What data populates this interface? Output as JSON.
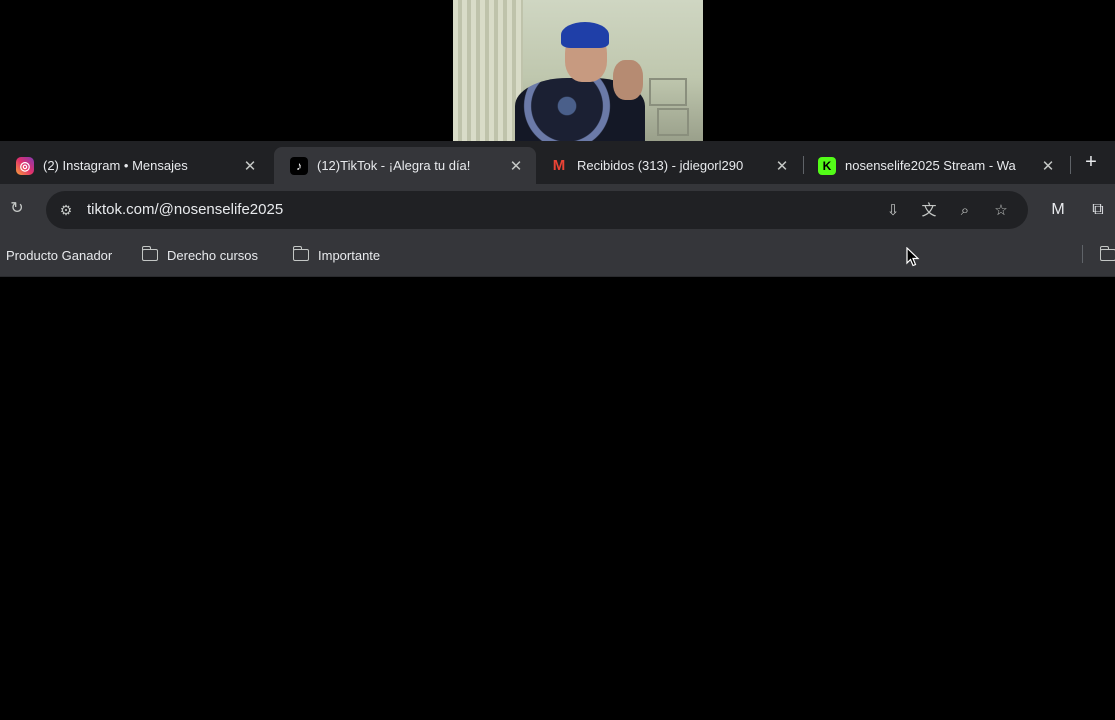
{
  "tabs": [
    {
      "title": "(2) Instagram • Mensajes",
      "favicon": "instagram-icon",
      "active": false
    },
    {
      "title": "(12)TikTok - ¡Alegra tu día!",
      "favicon": "tiktok-icon",
      "active": true
    },
    {
      "title": "Recibidos (313) - jdiegorl290",
      "favicon": "gmail-icon",
      "active": false
    },
    {
      "title": "nosenselife2025 Stream - Wa",
      "favicon": "kick-icon",
      "active": false
    }
  ],
  "toolbar": {
    "url": "tiktok.com/@nosenselife2025"
  },
  "bookmarks": [
    {
      "label": "Producto Ganador",
      "folder": false
    },
    {
      "label": "Derecho cursos",
      "folder": true
    },
    {
      "label": "Importante",
      "folder": true
    }
  ],
  "colors": {
    "tabstrip": "#202124",
    "toolbar": "#35363a",
    "omnibox": "#202124",
    "page": "#000000"
  },
  "glyphs": {
    "close": "✕",
    "newtab": "+",
    "reload": "↻",
    "tune": "⚙",
    "install": "⇩",
    "translate": "文",
    "zoom": "⌕",
    "star": "☆",
    "extension": "⧉",
    "instagram": "◎",
    "tiktok": "♪",
    "gmail": "M",
    "kick": "K",
    "malwarebytes": "M"
  }
}
